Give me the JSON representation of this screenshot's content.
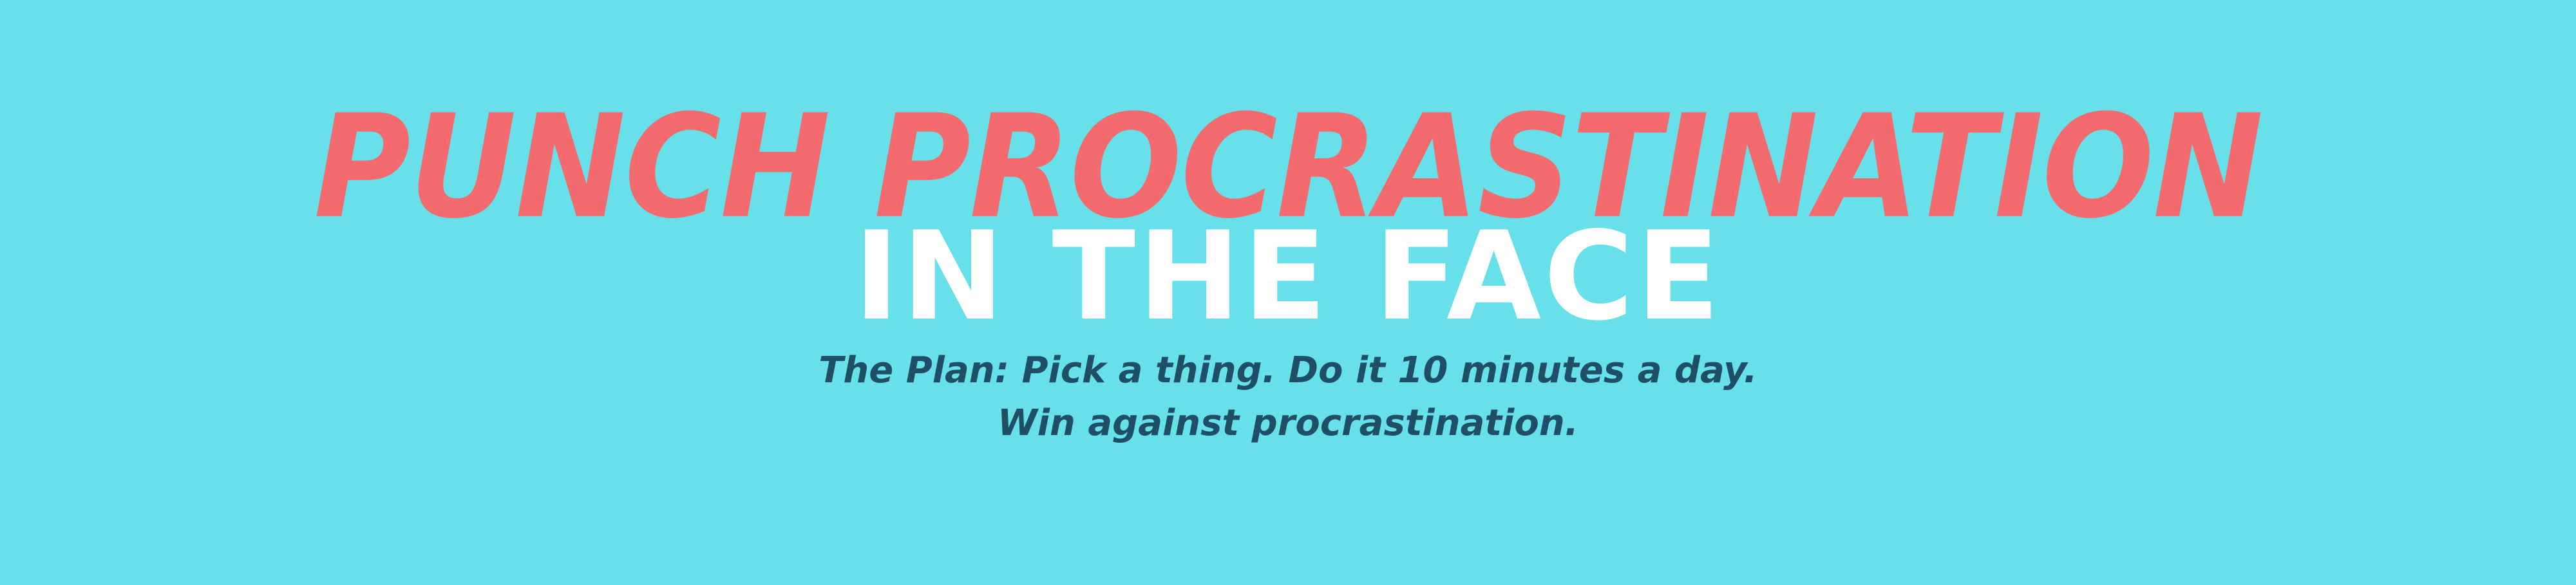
{
  "banner": {
    "headline_line1": "PUNCH PROCRASTINATION",
    "headline_line2": "IN THE FACE",
    "tagline_line1": "The Plan: Pick a thing. Do it 10 minutes a day.",
    "tagline_line2": "Win against procrastination."
  },
  "colors": {
    "background": "#68e0ea",
    "headline_accent": "#f36b6e",
    "headline_secondary": "#ffffff",
    "tagline": "#1f4f66"
  }
}
